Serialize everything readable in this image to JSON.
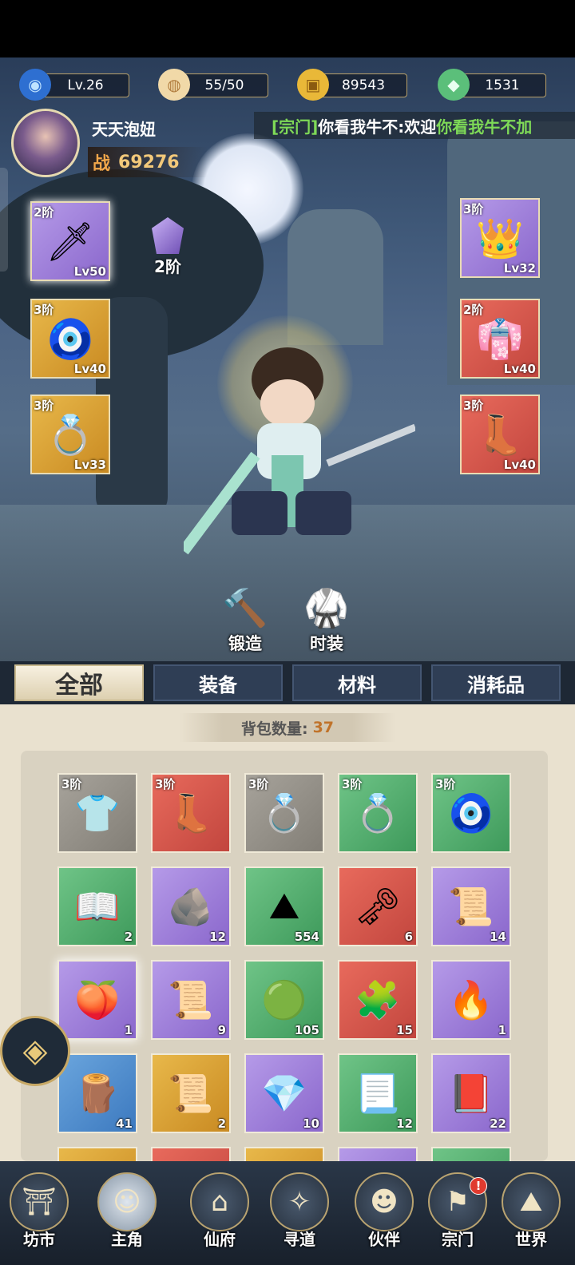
{
  "resources": {
    "level": "Lv.26",
    "stamina": "55/50",
    "coins": "89543",
    "jade": "1531"
  },
  "player": {
    "name": "天天泡妞",
    "power_label": "战",
    "power_value": "69276"
  },
  "ticker": {
    "tag": "[宗门]",
    "text1": "你看我牛不:",
    "text2": " 欢迎",
    "text3": "你看我牛不加"
  },
  "equipment": {
    "weapon": {
      "tier": "2阶",
      "level": "Lv50"
    },
    "gem": {
      "tier": "2阶"
    },
    "amulet": {
      "tier": "3阶",
      "level": "Lv40"
    },
    "ring": {
      "tier": "3阶",
      "level": "Lv33"
    },
    "helmet": {
      "tier": "3阶",
      "level": "Lv32"
    },
    "armor": {
      "tier": "2阶",
      "level": "Lv40"
    },
    "boots": {
      "tier": "3阶",
      "level": "Lv40"
    }
  },
  "actions": {
    "forge": "锻造",
    "costume": "时装"
  },
  "tabs": [
    "全部",
    "装备",
    "材料",
    "消耗品"
  ],
  "bag": {
    "count_label": "背包数量:",
    "count_value": "37",
    "items": [
      {
        "tier": "3阶",
        "count": "",
        "icon": "robe-icon"
      },
      {
        "tier": "3阶",
        "count": "",
        "icon": "boots-icon"
      },
      {
        "tier": "3阶",
        "count": "",
        "icon": "ring-icon"
      },
      {
        "tier": "3阶",
        "count": "",
        "icon": "ring-icon"
      },
      {
        "tier": "3阶",
        "count": "",
        "icon": "amulet-icon"
      },
      {
        "tier": "",
        "count": "2",
        "icon": "book-icon"
      },
      {
        "tier": "",
        "count": "12",
        "icon": "stone-icon"
      },
      {
        "tier": "",
        "count": "554",
        "icon": "ore-icon"
      },
      {
        "tier": "",
        "count": "6",
        "icon": "key-icon"
      },
      {
        "tier": "",
        "count": "14",
        "icon": "scroll-icon"
      },
      {
        "tier": "",
        "count": "1",
        "icon": "peach-icon"
      },
      {
        "tier": "",
        "count": "9",
        "icon": "scroll-icon"
      },
      {
        "tier": "",
        "count": "105",
        "icon": "orb-icon"
      },
      {
        "tier": "",
        "count": "15",
        "icon": "shard-icon"
      },
      {
        "tier": "",
        "count": "1",
        "icon": "flame-icon"
      },
      {
        "tier": "",
        "count": "41",
        "icon": "log-icon"
      },
      {
        "tier": "",
        "count": "2",
        "icon": "scroll-icon"
      },
      {
        "tier": "",
        "count": "10",
        "icon": "crystal-icon"
      },
      {
        "tier": "",
        "count": "12",
        "icon": "paper-icon"
      },
      {
        "tier": "",
        "count": "22",
        "icon": "tome-icon"
      }
    ]
  },
  "nav": [
    "坊市",
    "主角",
    "仙府",
    "寻道",
    "伙伴",
    "宗门",
    "世界"
  ],
  "nav_badge": "!"
}
